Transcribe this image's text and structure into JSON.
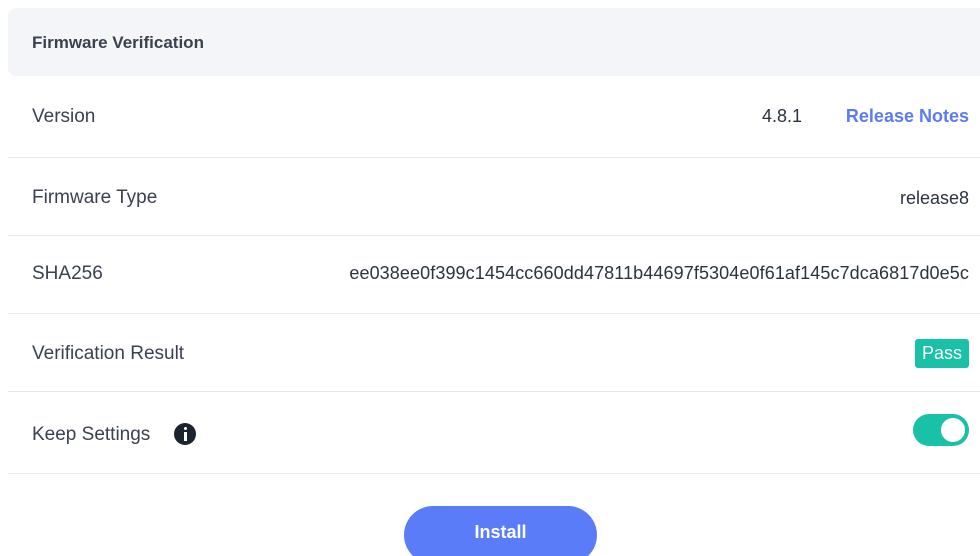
{
  "header": {
    "title": "Firmware Verification"
  },
  "rows": {
    "version": {
      "label": "Version",
      "value": "4.8.1",
      "link_label": "Release Notes"
    },
    "firmware_type": {
      "label": "Firmware Type",
      "value": "release8"
    },
    "sha256": {
      "label": "SHA256",
      "value": "ee038ee0f399c1454cc660dd47811b44697f5304e0f61af145c7dca6817d0e5c"
    },
    "verification_result": {
      "label": "Verification Result",
      "badge": "Pass"
    },
    "keep_settings": {
      "label": "Keep Settings",
      "icon": "info-icon",
      "enabled": true
    }
  },
  "actions": {
    "install_label": "Install"
  },
  "colors": {
    "accent": "#5b7cf8",
    "success": "#19c2a6",
    "link": "#5b7cf0"
  }
}
